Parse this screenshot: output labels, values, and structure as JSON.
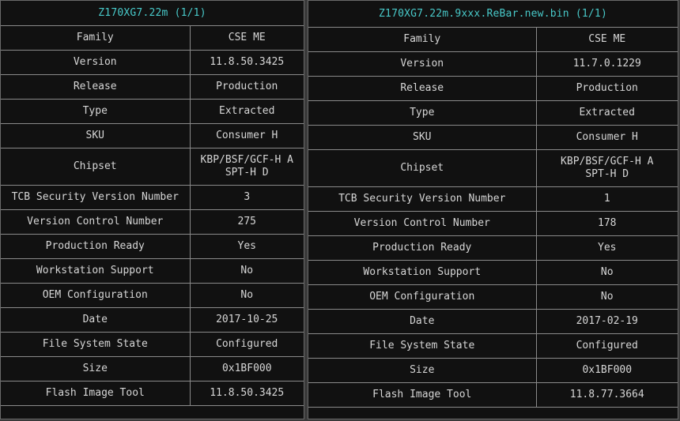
{
  "left": {
    "title": "Z170XG7.22m (1/1)",
    "rows": [
      {
        "key": "Family",
        "value": "CSE ME"
      },
      {
        "key": "Version",
        "value": "11.8.50.3425"
      },
      {
        "key": "Release",
        "value": "Production"
      },
      {
        "key": "Type",
        "value": "Extracted"
      },
      {
        "key": "SKU",
        "value": "Consumer H"
      },
      {
        "key": "Chipset",
        "value": "KBP/BSF/GCF-H A\nSPT-H D"
      },
      {
        "key": "TCB Security Version Number",
        "value": "3"
      },
      {
        "key": "Version Control Number",
        "value": "275"
      },
      {
        "key": "Production Ready",
        "value": "Yes"
      },
      {
        "key": "Workstation Support",
        "value": "No"
      },
      {
        "key": "OEM Configuration",
        "value": "No"
      },
      {
        "key": "Date",
        "value": "2017-10-25"
      },
      {
        "key": "File System State",
        "value": "Configured"
      },
      {
        "key": "Size",
        "value": "0x1BF000"
      },
      {
        "key": "Flash Image Tool",
        "value": "11.8.50.3425"
      }
    ]
  },
  "right": {
    "title": "Z170XG7.22m.9xxx.ReBar.new.bin (1/1)",
    "rows": [
      {
        "key": "Family",
        "value": "CSE ME"
      },
      {
        "key": "Version",
        "value": "11.7.0.1229"
      },
      {
        "key": "Release",
        "value": "Production"
      },
      {
        "key": "Type",
        "value": "Extracted"
      },
      {
        "key": "SKU",
        "value": "Consumer H"
      },
      {
        "key": "Chipset",
        "value": "KBP/BSF/GCF-H A\nSPT-H D"
      },
      {
        "key": "TCB Security Version Number",
        "value": "1"
      },
      {
        "key": "Version Control Number",
        "value": "178"
      },
      {
        "key": "Production Ready",
        "value": "Yes"
      },
      {
        "key": "Workstation Support",
        "value": "No"
      },
      {
        "key": "OEM Configuration",
        "value": "No"
      },
      {
        "key": "Date",
        "value": "2017-02-19"
      },
      {
        "key": "File System State",
        "value": "Configured"
      },
      {
        "key": "Size",
        "value": "0x1BF000"
      },
      {
        "key": "Flash Image Tool",
        "value": "11.8.77.3664"
      }
    ]
  },
  "colors": {
    "title": "#48c9c9",
    "text": "#d6d6d6",
    "background": "#111111",
    "border": "#8a8a8a"
  }
}
